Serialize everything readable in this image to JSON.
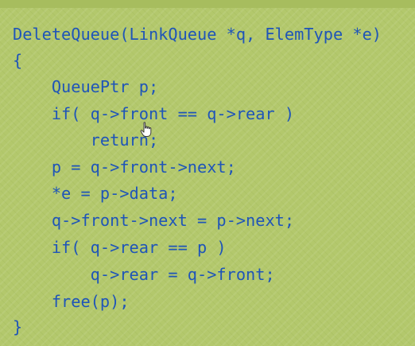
{
  "code": {
    "lines": [
      "DeleteQueue(LinkQueue *q, ElemType *e)",
      "{",
      "    QueuePtr p;",
      "    if( q->front == q->rear )",
      "        return;",
      "    p = q->front->next;",
      "    *e = p->data;",
      "    q->front->next = p->next;",
      "    if( q->rear == p )",
      "        q->rear = q->front;",
      "    free(p);",
      "}"
    ]
  },
  "colors": {
    "background": "#b3c86c",
    "code_text": "#1f55b8"
  },
  "icons": {
    "cursor": "hand-pointer-icon"
  }
}
